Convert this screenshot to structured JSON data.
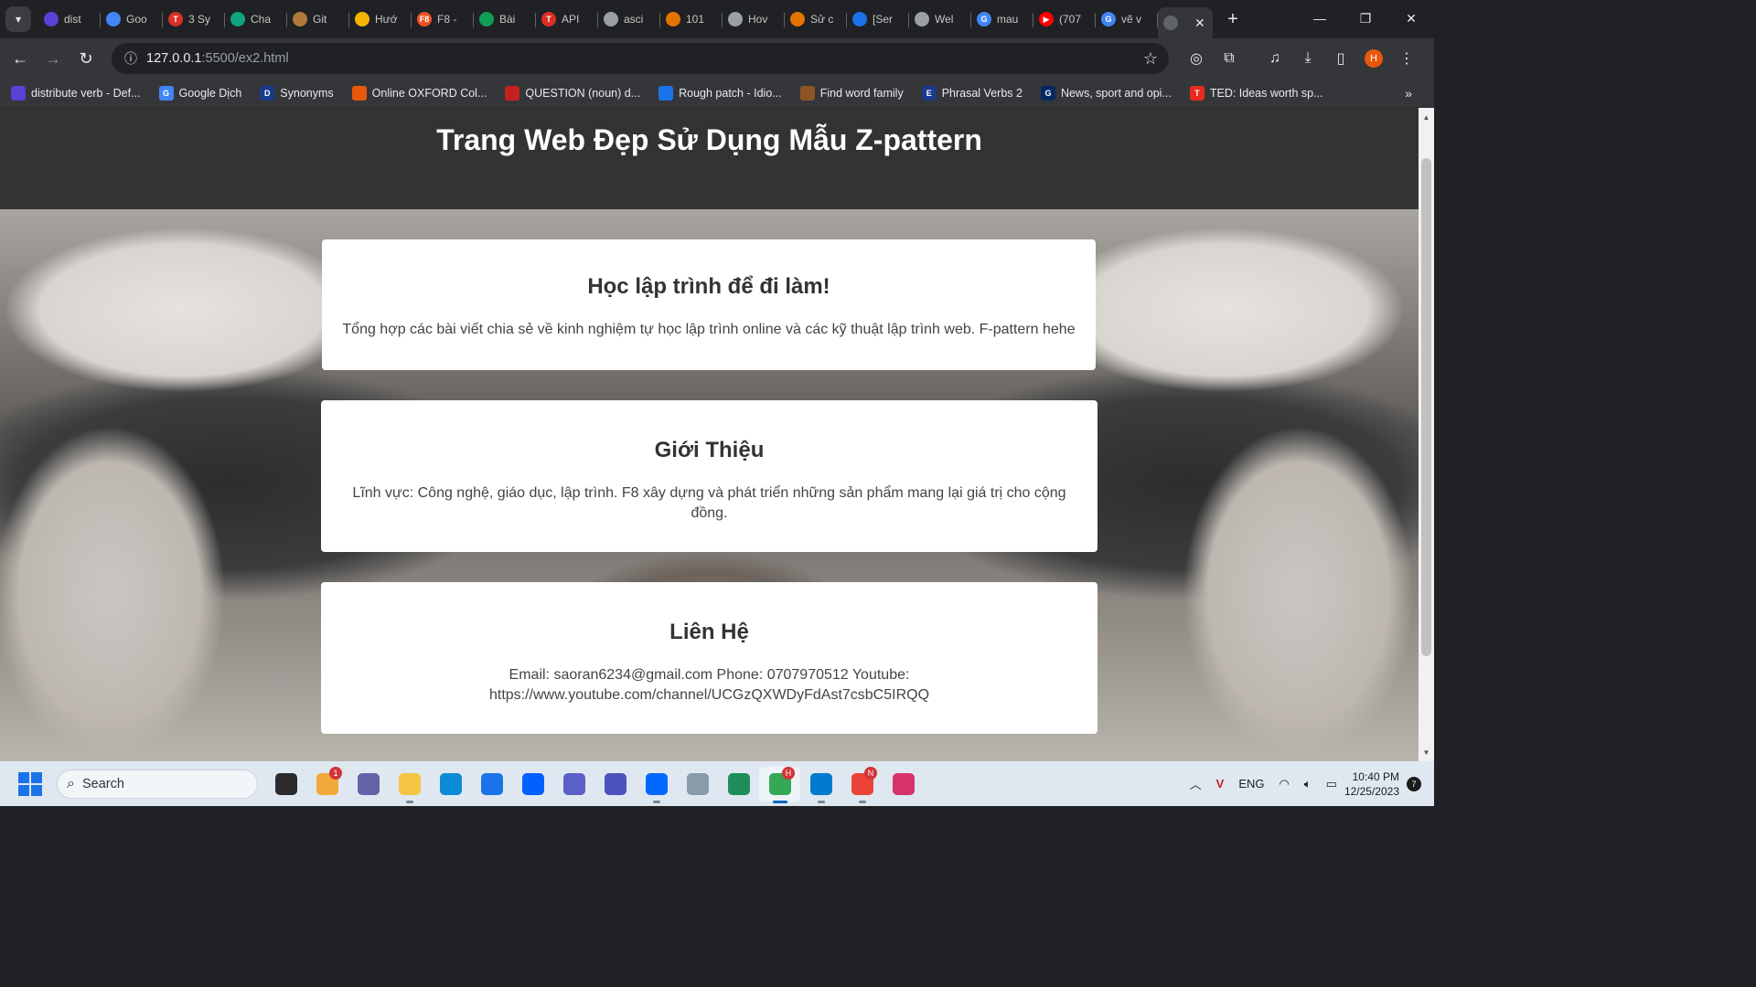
{
  "browser": {
    "tabs": [
      {
        "title": "dist",
        "color": "#5b3fd6",
        "glyph": ""
      },
      {
        "title": "Goo",
        "color": "#4285f4",
        "glyph": ""
      },
      {
        "title": "3 Sy",
        "color": "#d93025",
        "glyph": "T"
      },
      {
        "title": "Cha",
        "color": "#10a37f",
        "glyph": ""
      },
      {
        "title": "Git",
        "color": "#b07a3a",
        "glyph": ""
      },
      {
        "title": "Hướ",
        "color": "#f4b400",
        "glyph": ""
      },
      {
        "title": "F8 -",
        "color": "#f05123",
        "glyph": "F8"
      },
      {
        "title": "Bài",
        "color": "#0f9d58",
        "glyph": ""
      },
      {
        "title": "API",
        "color": "#d93025",
        "glyph": "T"
      },
      {
        "title": "asci",
        "color": "#9aa0a6",
        "glyph": ""
      },
      {
        "title": "101",
        "color": "#e37400",
        "glyph": ""
      },
      {
        "title": "Hov",
        "color": "#9aa0a6",
        "glyph": ""
      },
      {
        "title": "Sử c",
        "color": "#e37400",
        "glyph": ""
      },
      {
        "title": "[Ser",
        "color": "#1a73e8",
        "glyph": ""
      },
      {
        "title": "Wel",
        "color": "#9aa0a6",
        "glyph": ""
      },
      {
        "title": "mau",
        "color": "#4285f4",
        "glyph": "G"
      },
      {
        "title": "(707",
        "color": "#ff0000",
        "glyph": "▶"
      },
      {
        "title": "vẽ v",
        "color": "#4285f4",
        "glyph": "G"
      }
    ],
    "active_tab": {
      "title": "",
      "color": "#5f6368"
    },
    "url_host": "127.0.0.1",
    "url_path": ":5500/ex2.html",
    "profile_initial": "H",
    "bookmarks": [
      {
        "label": "distribute verb - Def...",
        "color": "#5b3fd6",
        "glyph": ""
      },
      {
        "label": "Google Dịch",
        "color": "#4285f4",
        "glyph": "G"
      },
      {
        "label": "Synonyms",
        "color": "#1a3a8a",
        "glyph": "D"
      },
      {
        "label": "Online OXFORD Col...",
        "color": "#e8580c",
        "glyph": ""
      },
      {
        "label": "QUESTION (noun) d...",
        "color": "#c5221f",
        "glyph": ""
      },
      {
        "label": "Rough patch - Idio...",
        "color": "#1a73e8",
        "glyph": ""
      },
      {
        "label": "Find word family",
        "color": "#8d5524",
        "glyph": ""
      },
      {
        "label": "Phrasal Verbs  2",
        "color": "#1a3a8a",
        "glyph": "E"
      },
      {
        "label": "News, sport and opi...",
        "color": "#052962",
        "glyph": "G"
      },
      {
        "label": "TED: Ideas worth sp...",
        "color": "#e62b1e",
        "glyph": "T"
      }
    ]
  },
  "page": {
    "header_title": "Trang Web Đẹp Sử Dụng Mẫu Z-pattern",
    "cards": [
      {
        "title": "Học lập trình để đi làm!",
        "text": "Tổng hợp các bài viết chia sẻ về kinh nghiệm tự học lập trình online và các kỹ thuật lập trình web. F-pattern hehe"
      },
      {
        "title": "Giới Thiệu",
        "text": "Lĩnh vực: Công nghệ, giáo dục, lập trình. F8 xây dựng và phát triển những sản phẩm mang lại giá trị cho cộng đồng."
      },
      {
        "title": "Liên Hệ",
        "text": "Email: saoran6234@gmail.com Phone: 0707970512 Youtube: https://www.youtube.com/channel/UCGzQXWDyFdAst7csbC5IRQQ"
      }
    ]
  },
  "taskbar": {
    "search_placeholder": "Search",
    "apps": [
      {
        "name": "task-view",
        "color": "#2b2b2b",
        "badge": "",
        "open": false,
        "active": false
      },
      {
        "name": "weather",
        "color": "#f2a93b",
        "badge": "1",
        "open": false,
        "active": false
      },
      {
        "name": "meet",
        "color": "#6264a7",
        "badge": "",
        "open": false,
        "active": false
      },
      {
        "name": "file-explorer",
        "color": "#f4c542",
        "badge": "",
        "open": true,
        "active": false
      },
      {
        "name": "edge",
        "color": "#0c8bd6",
        "badge": "",
        "open": false,
        "active": false
      },
      {
        "name": "store",
        "color": "#1a73e8",
        "badge": "",
        "open": false,
        "active": false
      },
      {
        "name": "dropbox",
        "color": "#0061fe",
        "badge": "",
        "open": false,
        "active": false
      },
      {
        "name": "teams-personal",
        "color": "#5b5fc7",
        "badge": "",
        "open": false,
        "active": false
      },
      {
        "name": "teams-work",
        "color": "#4b53bc",
        "badge": "",
        "open": false,
        "active": false
      },
      {
        "name": "zalo",
        "color": "#0068ff",
        "badge": "",
        "open": true,
        "active": false
      },
      {
        "name": "settings",
        "color": "#8a9aa8",
        "badge": "",
        "open": false,
        "active": false
      },
      {
        "name": "monitor",
        "color": "#1e8e5a",
        "badge": "",
        "open": false,
        "active": false
      },
      {
        "name": "chrome-h",
        "color": "#34a853",
        "badge": "H",
        "open": true,
        "active": true
      },
      {
        "name": "vscode",
        "color": "#007acc",
        "badge": "",
        "open": true,
        "active": false
      },
      {
        "name": "chrome-n",
        "color": "#ea4335",
        "badge": "N",
        "open": true,
        "active": false
      },
      {
        "name": "app-w",
        "color": "#d6336c",
        "badge": "",
        "open": false,
        "active": false
      }
    ],
    "lang": "ENG",
    "time": "10:40 PM",
    "date": "12/25/2023",
    "notification_count": "7"
  }
}
